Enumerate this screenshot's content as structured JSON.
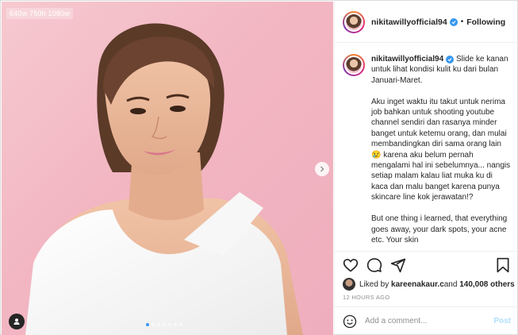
{
  "media": {
    "resolution_label": "640w 750h 1080w",
    "carousel": {
      "count": 7,
      "active_index": 0
    },
    "icons": {
      "next": "chevron-right-icon",
      "tags": "user-tag-icon"
    }
  },
  "header": {
    "username": "nikitawillyofficial94",
    "separator": "•",
    "follow_label": "Following"
  },
  "caption": {
    "username": "nikitawillyofficial94",
    "text": "Slide ke kanan untuk lihat kondisi kulit ku dari bulan Januari-Maret.\n\nAku inget waktu itu takut untuk nerima job bahkan untuk shooting youtube channel sendiri dan rasanya minder banget untuk ketemu orang, dan mulai membandingkan diri sama orang lain 😢 karena aku belum pernah mengalami hal ini sebelumnya... nangis setiap malam kalau liat muka ku di kaca dan malu banget karena punya skincare line kok jerawatan!?\n\nBut one thing i learned, that everything goes away, your dark spots, your acne etc. Your skin"
  },
  "actions": {
    "icons": [
      "heart-icon",
      "comment-icon",
      "share-icon",
      "bookmark-icon"
    ],
    "likes_prefix": "Liked by ",
    "likes_user": "kareenakaur.c",
    "likes_middle": " and ",
    "likes_count": "140,008 others",
    "timestamp": "12 HOURS AGO"
  },
  "comment": {
    "placeholder": "Add a comment...",
    "post_label": "Post"
  },
  "colors": {
    "accent": "#3897f0",
    "background_pink": "#f2b6c2",
    "post_disabled": "#b2dffc"
  }
}
